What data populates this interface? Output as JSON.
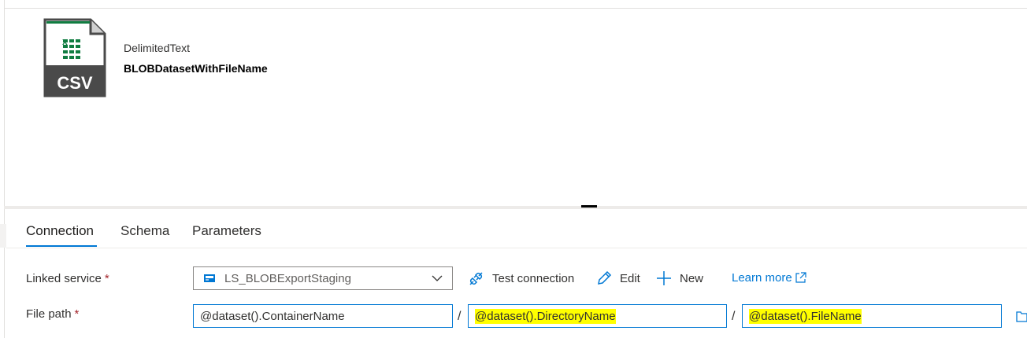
{
  "dataset": {
    "type_label": "DelimitedText",
    "name": "BLOBDatasetWithFileName",
    "icon": "csv-file-icon",
    "icon_text": "CSV"
  },
  "tabs": [
    {
      "label": "Connection",
      "active": true
    },
    {
      "label": "Schema",
      "active": false
    },
    {
      "label": "Parameters",
      "active": false
    }
  ],
  "form": {
    "linked_service": {
      "label": "Linked service",
      "required_mark": "*",
      "value": "LS_BLOBExportStaging"
    },
    "actions": {
      "test_connection": "Test connection",
      "edit": "Edit",
      "new": "New",
      "learn_more": "Learn more"
    },
    "file_path": {
      "label": "File path",
      "required_mark": "*",
      "container": "@dataset().ContainerName",
      "separator": "/",
      "directory": "@dataset().DirectoryName",
      "file": "@dataset().FileName"
    }
  },
  "colors": {
    "accent": "#0078d4",
    "highlight": "#ffff00",
    "required": "#a4262c",
    "excel_green": "#107c41"
  }
}
